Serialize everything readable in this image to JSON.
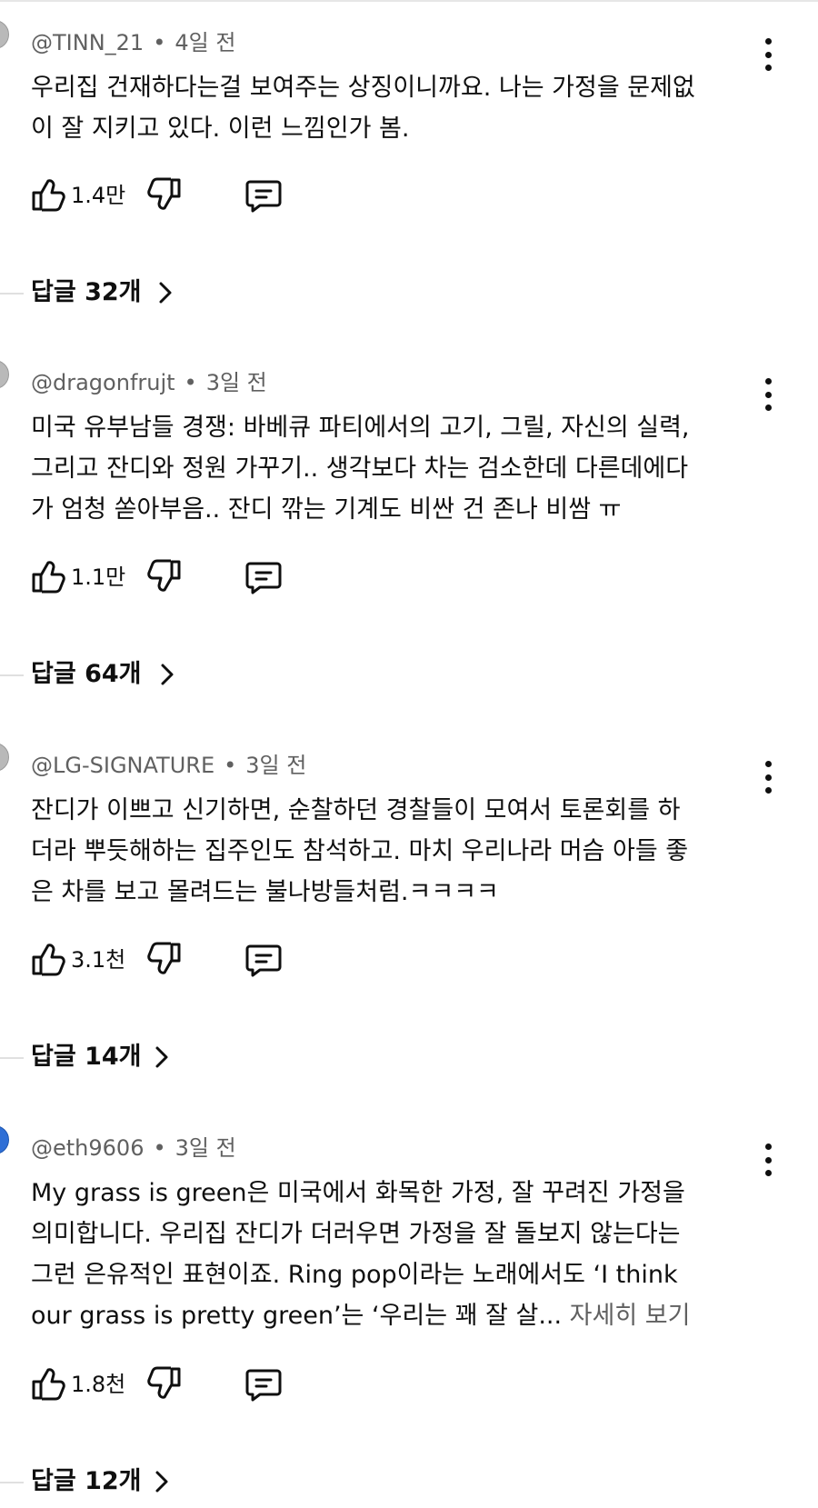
{
  "comments": [
    {
      "author": "@TINN_21",
      "time": "4일 전",
      "lines": [
        "우리집 건재하다는걸 보여주는 상징이니까요. 나는 가정을 문제없",
        "이 잘 지키고 있다. 이런 느낌인가 봄."
      ],
      "likes": "1.4만",
      "replies": "답글 32개"
    },
    {
      "author": "@dragonfrujt",
      "time": "3일 전",
      "lines": [
        "미국 유부남들 경쟁: 바베큐 파티에서의 고기, 그릴, 자신의 실력,",
        "그리고 잔디와 정원 가꾸기.. 생각보다 차는 검소한데 다른데에다",
        "가 엄청 쏟아부음.. 잔디 깎는 기계도 비싼 건 존나 비쌈 ㅠ"
      ],
      "likes": "1.1만",
      "replies": "답글 64개"
    },
    {
      "author": "@LG-SIGNATURE",
      "time": "3일 전",
      "lines": [
        "잔디가 이쁘고 신기하면, 순찰하던 경찰들이 모여서 토론회를 하",
        "더라 뿌듯해하는 집주인도 참석하고. 마치 우리나라 머슴 아들  좋",
        "은 차를 보고 몰려드는 불나방들처럼.ㅋㅋㅋㅋ"
      ],
      "likes": "3.1천",
      "replies": "답글 14개"
    },
    {
      "author": "@eth9606",
      "time": "3일 전",
      "lines": [
        "My grass is green은 미국에서 화목한 가정, 잘 꾸려진 가정을",
        "의미합니다. 우리집 잔디가 더러우면 가정을 잘 돌보지 않는다는",
        "그런 은유적인 표현이죠. Ring pop이라는 노래에서도 ‘I think",
        "our grass is pretty green’는 ‘우리는 꽤 잘 살..."
      ],
      "read_more": "자세히 보기",
      "likes": "1.8천",
      "replies": "답글 12개"
    }
  ],
  "icons": {
    "like": "thumb-up-icon",
    "dislike": "thumb-down-icon",
    "reply": "comment-icon",
    "more": "more-vert-icon",
    "chevron": "chevron-right-icon"
  },
  "colors": {
    "text": "#0f0f0f",
    "secondary": "#606060",
    "divider": "#e0e0e0"
  }
}
